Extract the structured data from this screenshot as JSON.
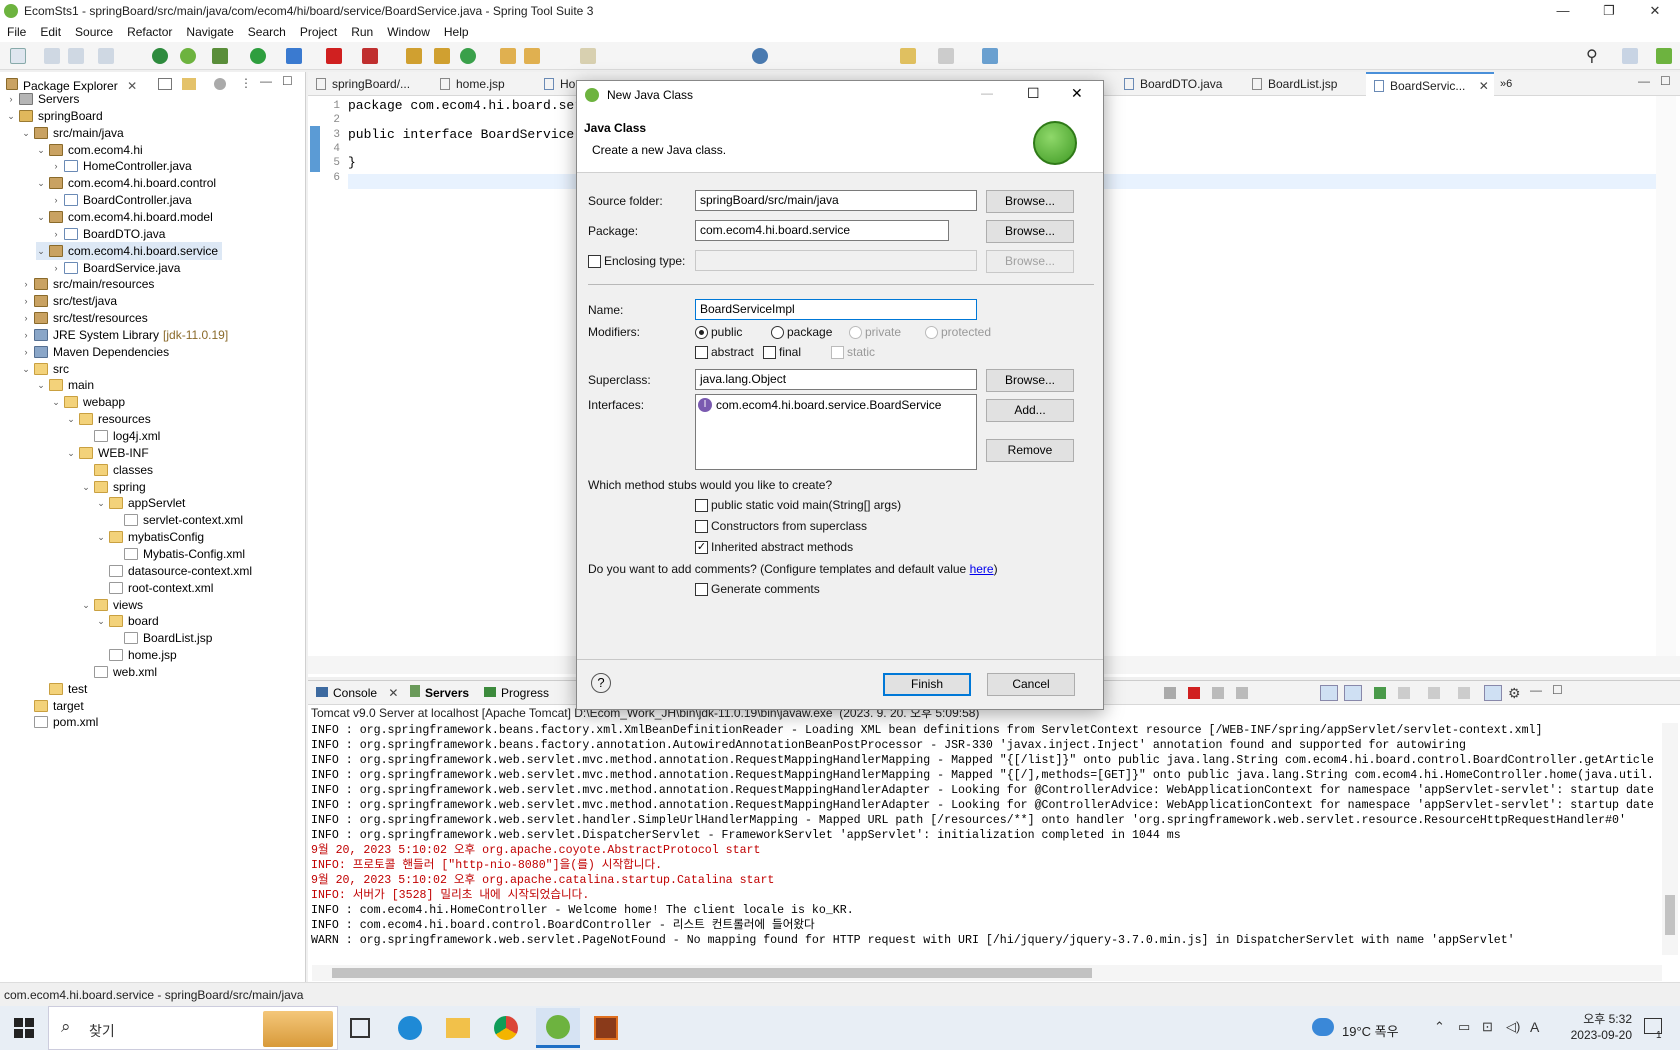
{
  "window": {
    "title": "EcomSts1 - springBoard/src/main/java/com/ecom4/hi/board/service/BoardService.java - Spring Tool Suite 3"
  },
  "menu": [
    "File",
    "Edit",
    "Source",
    "Refactor",
    "Navigate",
    "Search",
    "Project",
    "Run",
    "Window",
    "Help"
  ],
  "package_explorer": {
    "tab_label": "Package Explorer",
    "items": [
      {
        "label": "Servers",
        "icon": "srv"
      },
      {
        "label": "springBoard",
        "icon": "proj"
      },
      {
        "label": "src/main/java",
        "icon": "pkg"
      },
      {
        "label": "com.ecom4.hi",
        "icon": "pkg"
      },
      {
        "label": "HomeController.java",
        "icon": "java"
      },
      {
        "label": "com.ecom4.hi.board.control",
        "icon": "pkg"
      },
      {
        "label": "BoardController.java",
        "icon": "java"
      },
      {
        "label": "com.ecom4.hi.board.model",
        "icon": "pkg"
      },
      {
        "label": "BoardDTO.java",
        "icon": "java"
      },
      {
        "label": "com.ecom4.hi.board.service",
        "icon": "pkg"
      },
      {
        "label": "BoardService.java",
        "icon": "java"
      },
      {
        "label": "src/main/resources",
        "icon": "pkg"
      },
      {
        "label": "src/test/java",
        "icon": "pkg"
      },
      {
        "label": "src/test/resources",
        "icon": "pkg"
      },
      {
        "label": "JRE System Library",
        "icon": "lib"
      },
      {
        "label": "Maven Dependencies",
        "icon": "lib"
      },
      {
        "label": "src",
        "icon": "fold"
      },
      {
        "label": "main",
        "icon": "fold"
      },
      {
        "label": "webapp",
        "icon": "fold"
      },
      {
        "label": "resources",
        "icon": "fold"
      },
      {
        "label": "log4j.xml",
        "icon": "xml"
      },
      {
        "label": "WEB-INF",
        "icon": "fold"
      },
      {
        "label": "classes",
        "icon": "fold"
      },
      {
        "label": "spring",
        "icon": "fold"
      },
      {
        "label": "appServlet",
        "icon": "fold"
      },
      {
        "label": "servlet-context.xml",
        "icon": "xml"
      },
      {
        "label": "mybatisConfig",
        "icon": "fold"
      },
      {
        "label": "Mybatis-Config.xml",
        "icon": "xml"
      },
      {
        "label": "datasource-context.xml",
        "icon": "xml"
      },
      {
        "label": "root-context.xml",
        "icon": "xml"
      },
      {
        "label": "views",
        "icon": "fold"
      },
      {
        "label": "board",
        "icon": "fold"
      },
      {
        "label": "BoardList.jsp",
        "icon": "xml"
      },
      {
        "label": "home.jsp",
        "icon": "xml"
      },
      {
        "label": "web.xml",
        "icon": "xml"
      },
      {
        "label": "test",
        "icon": "fold"
      },
      {
        "label": "target",
        "icon": "fold"
      },
      {
        "label": "pom.xml",
        "icon": "xml"
      }
    ],
    "jre_suffix": "[jdk-11.0.19]"
  },
  "editor": {
    "tabs": [
      "springBoard/...",
      "home.jsp",
      "Ho",
      "BoardDTO.java",
      "BoardList.jsp",
      "BoardServic...",
      "»6"
    ],
    "lines": [
      "package com.ecom4.hi.board.servic",
      "",
      "public interface BoardService {",
      "",
      "}",
      ""
    ],
    "line_numbers": [
      "1",
      "2",
      "3",
      "4",
      "5",
      "6"
    ]
  },
  "dialog": {
    "title": "New Java Class",
    "header_title": "Java Class",
    "header_desc": "Create a new Java class.",
    "source_folder_label": "Source folder:",
    "source_folder_value": "springBoard/src/main/java",
    "package_label": "Package:",
    "package_value": "com.ecom4.hi.board.service",
    "enclosing_label": "Enclosing type:",
    "browse": "Browse...",
    "name_label": "Name:",
    "name_value": "BoardServiceImpl",
    "modifiers_label": "Modifiers:",
    "mod_public": "public",
    "mod_package": "package",
    "mod_private": "private",
    "mod_protected": "protected",
    "mod_abstract": "abstract",
    "mod_final": "final",
    "mod_static": "static",
    "superclass_label": "Superclass:",
    "superclass_value": "java.lang.Object",
    "interfaces_label": "Interfaces:",
    "interface_value": "com.ecom4.hi.board.service.BoardService",
    "add": "Add...",
    "remove": "Remove",
    "stubs_question": "Which method stubs would you like to create?",
    "stub_main": "public static void main(String[] args)",
    "stub_constructors": "Constructors from superclass",
    "stub_inherited": "Inherited abstract methods",
    "comments_question": "Do you want to add comments? (Configure templates and default value ",
    "here": "here",
    "comments_close": ")",
    "generate_comments": "Generate comments",
    "finish": "Finish",
    "cancel": "Cancel",
    "help": "?"
  },
  "console": {
    "tabs": [
      "Console",
      "Servers",
      "Progress"
    ],
    "header": "Tomcat v9.0 Server at localhost [Apache Tomcat] D:\\Ecom_Work_JH\\bin\\jdk-11.0.19\\bin\\javaw.exe  (2023. 9. 20. 오후 5:09:58)",
    "lines": [
      {
        "t": "INFO : org.springframework.beans.factory.xml.XmlBeanDefinitionReader - Loading XML bean definitions from ServletContext resource [/WEB-INF/spring/appServlet/servlet-context.xml]",
        "c": "#000"
      },
      {
        "t": "INFO : org.springframework.beans.factory.annotation.AutowiredAnnotationBeanPostProcessor - JSR-330 'javax.inject.Inject' annotation found and supported for autowiring",
        "c": "#000"
      },
      {
        "t": "INFO : org.springframework.web.servlet.mvc.method.annotation.RequestMappingHandlerMapping - Mapped \"{[/list]}\" onto public java.lang.String com.ecom4.hi.board.control.BoardController.getArticle",
        "c": "#000"
      },
      {
        "t": "INFO : org.springframework.web.servlet.mvc.method.annotation.RequestMappingHandlerMapping - Mapped \"{[/],methods=[GET]}\" onto public java.lang.String com.ecom4.hi.HomeController.home(java.util.",
        "c": "#000"
      },
      {
        "t": "INFO : org.springframework.web.servlet.mvc.method.annotation.RequestMappingHandlerAdapter - Looking for @ControllerAdvice: WebApplicationContext for namespace 'appServlet-servlet': startup date",
        "c": "#000"
      },
      {
        "t": "INFO : org.springframework.web.servlet.mvc.method.annotation.RequestMappingHandlerAdapter - Looking for @ControllerAdvice: WebApplicationContext for namespace 'appServlet-servlet': startup date",
        "c": "#000"
      },
      {
        "t": "INFO : org.springframework.web.servlet.handler.SimpleUrlHandlerMapping - Mapped URL path [/resources/**] onto handler 'org.springframework.web.servlet.resource.ResourceHttpRequestHandler#0'",
        "c": "#000"
      },
      {
        "t": "INFO : org.springframework.web.servlet.DispatcherServlet - FrameworkServlet 'appServlet': initialization completed in 1044 ms",
        "c": "#000"
      },
      {
        "t": "9월 20, 2023 5:10:02 오후 org.apache.coyote.AbstractProtocol start",
        "c": "#c00000"
      },
      {
        "t": "INFO: 프로토콜 핸들러 [\"http-nio-8080\"]을(를) 시작합니다.",
        "c": "#c00000"
      },
      {
        "t": "9월 20, 2023 5:10:02 오후 org.apache.catalina.startup.Catalina start",
        "c": "#c00000"
      },
      {
        "t": "INFO: 서버가 [3528] 밀리초 내에 시작되었습니다.",
        "c": "#c00000"
      },
      {
        "t": "INFO : com.ecom4.hi.HomeController - Welcome home! The client locale is ko_KR.",
        "c": "#000"
      },
      {
        "t": "INFO : com.ecom4.hi.board.control.BoardController - 리스트 컨트롤러에 들어왔다",
        "c": "#000"
      },
      {
        "t": "WARN : org.springframework.web.servlet.PageNotFound - No mapping found for HTTP request with URI [/hi/jquery/jquery-3.7.0.min.js] in DispatcherServlet with name 'appServlet'",
        "c": "#000"
      }
    ]
  },
  "status_bar": {
    "text": "com.ecom4.hi.board.service - springBoard/src/main/java"
  },
  "taskbar": {
    "search": "찾기",
    "weather": "19°C  폭우",
    "ime": "A",
    "time": "오후 5:32",
    "date": "2023-09-20",
    "notif": "1"
  },
  "colors": {
    "accent": "#0078d7",
    "link": "#0000ee",
    "selection": "#dde8f5",
    "spring_green": "#6db33f"
  }
}
